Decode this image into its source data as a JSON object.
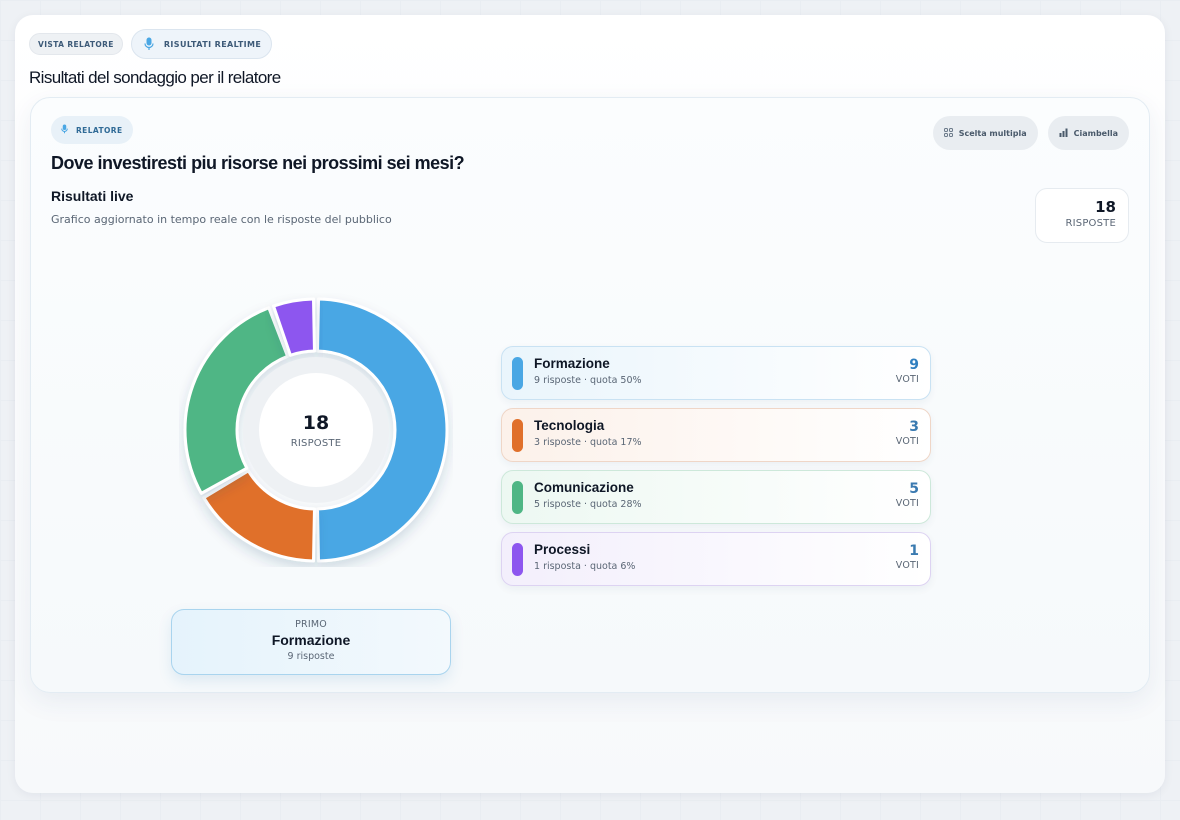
{
  "top": {
    "tab_speaker": "VISTA RELATORE",
    "tab_realtime": "RISULTATI REALTIME",
    "page_title": "Risultati del sondaggio per il relatore"
  },
  "card": {
    "role_label": "RELATORE",
    "chip_type": "Scelta multipla",
    "chip_chart": "Ciambella",
    "question": "Dove investiresti piu risorse nei prossimi sei mesi?",
    "section_title": "Risultati live",
    "section_subtitle": "Grafico aggiornato in tempo reale con le risposte del pubblico",
    "total_count": "18",
    "total_label": "RISPOSTE"
  },
  "donut": {
    "center_count": "18",
    "center_label": "RISPOSTE"
  },
  "leader": {
    "kicker": "PRIMO",
    "name": "Formazione",
    "sub": "9 risposte"
  },
  "options": [
    {
      "name": "Formazione",
      "meta": "9 risposte · quota 50%",
      "count": "9",
      "unit": "VOTI"
    },
    {
      "name": "Tecnologia",
      "meta": "3 risposte · quota 17%",
      "count": "3",
      "unit": "VOTI"
    },
    {
      "name": "Comunicazione",
      "meta": "5 risposte · quota 28%",
      "count": "5",
      "unit": "VOTI"
    },
    {
      "name": "Processi",
      "meta": "1 risposta · quota 6%",
      "count": "1",
      "unit": "VOTI"
    }
  ],
  "chart_data": {
    "type": "pie",
    "categories": [
      "Formazione",
      "Tecnologia",
      "Comunicazione",
      "Processi"
    ],
    "values": [
      9,
      3,
      5,
      1
    ],
    "colors": [
      "#4aa7e4",
      "#e0702b",
      "#4fb685",
      "#8d56ef"
    ]
  },
  "theme": {
    "row_backgrounds": [
      "#eaf5fc",
      "#fcf1ea",
      "#edf8f2",
      "#f3effc"
    ],
    "row_borders": [
      "#c9e2f3",
      "#efd6c7",
      "#cde8da",
      "#ddd3f2"
    ]
  }
}
